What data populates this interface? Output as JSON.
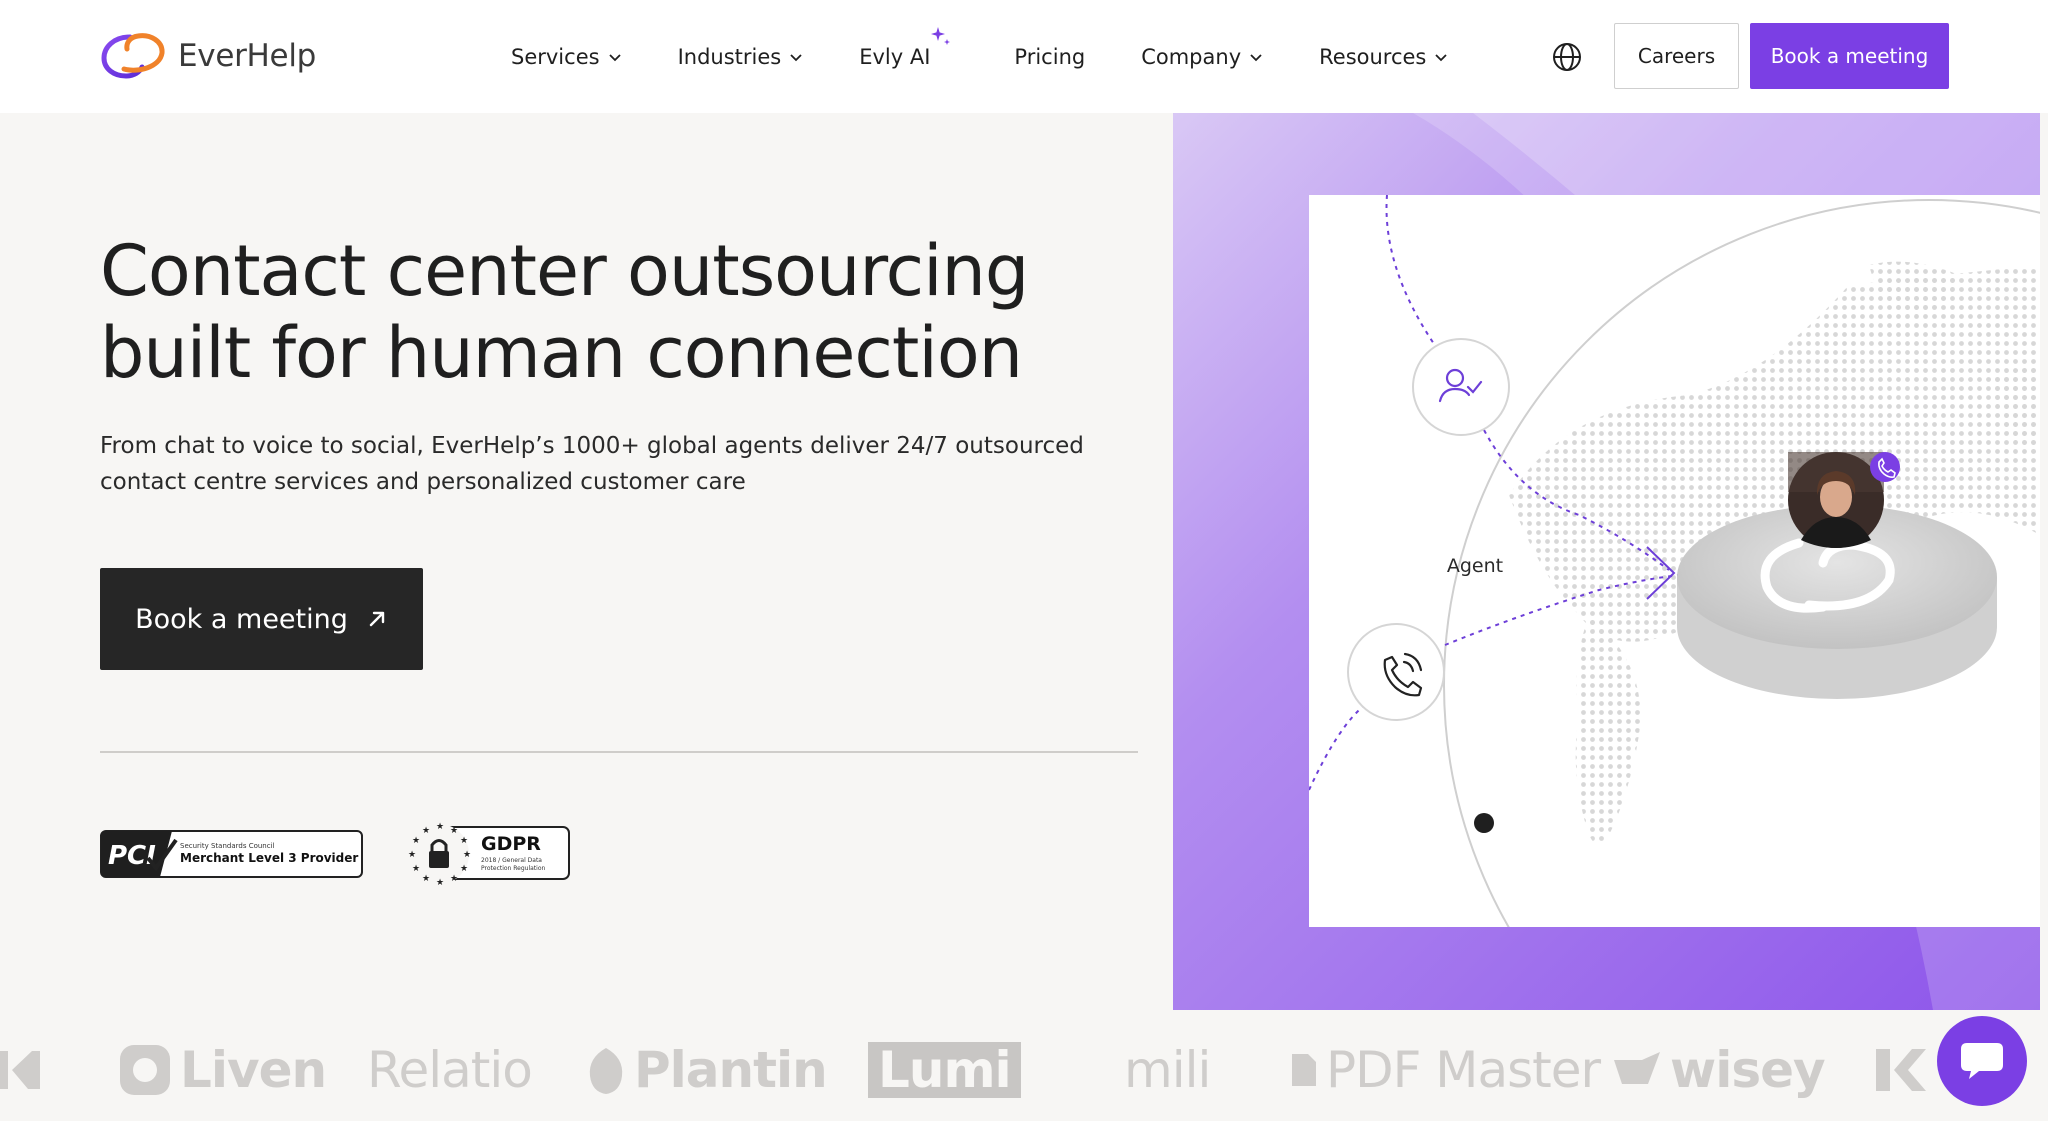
{
  "brand": {
    "name": "EverHelp",
    "accent_color": "#7b3fe4",
    "dark_color": "#262626"
  },
  "nav": {
    "items": [
      {
        "label": "Services",
        "has_dropdown": true
      },
      {
        "label": "Industries",
        "has_dropdown": true
      },
      {
        "label": "Evly AI",
        "has_dropdown": false,
        "icon": "sparkle-icon"
      },
      {
        "label": "Pricing",
        "has_dropdown": false
      },
      {
        "label": "Company",
        "has_dropdown": true
      },
      {
        "label": "Resources",
        "has_dropdown": true
      }
    ],
    "language_icon": "globe-icon",
    "careers_label": "Careers",
    "book_label": "Book a meeting"
  },
  "hero": {
    "title_line1": "Contact center outsourcing",
    "title_line2": "built for human connection",
    "subtitle": "From chat to voice to social, EverHelp’s 1000+ global agents deliver 24/7 outsourced contact centre services and personalized customer care",
    "cta_label": "Book a meeting",
    "cta_icon": "arrow-up-right-icon"
  },
  "badges": {
    "pci": {
      "mark": "PCI",
      "line1": "Security Standards Council",
      "line2": "Merchant Level 3 Provider"
    },
    "gdpr": {
      "title": "GDPR",
      "line1": "2018 / General Data",
      "line2": "Protection Regulation"
    }
  },
  "visual": {
    "agent_label": "Agent",
    "icons": [
      "user-check-icon",
      "phone-icon",
      "avatar",
      "logo-disc"
    ]
  },
  "clients": [
    "Liven",
    "Relatio",
    "Plantin",
    "Lumi",
    "mili",
    "PDF Master",
    "wisey"
  ],
  "chat": {
    "icon": "chat-bubble-icon"
  }
}
